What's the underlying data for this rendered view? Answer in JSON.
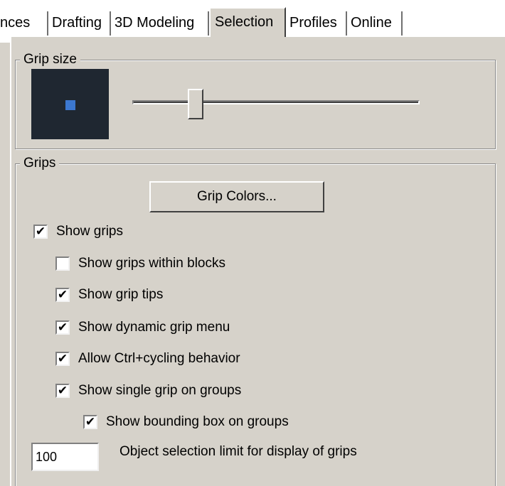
{
  "tabs": [
    {
      "label": "nces",
      "active": false
    },
    {
      "label": "Drafting",
      "active": false
    },
    {
      "label": "3D Modeling",
      "active": false
    },
    {
      "label": "Selection",
      "active": true
    },
    {
      "label": "Profiles",
      "active": false
    },
    {
      "label": "Online",
      "active": false
    }
  ],
  "grip_size": {
    "title": "Grip size",
    "preview_background": "#1f2731",
    "grip_color": "#3c78d0",
    "slider_level": 0.22
  },
  "grips": {
    "title": "Grips",
    "grip_colors_button": "Grip Colors...",
    "checkboxes": [
      {
        "label": "Show grips",
        "checked": true
      },
      {
        "label": "Show grips within blocks",
        "checked": false
      },
      {
        "label": "Show grip tips",
        "checked": true
      },
      {
        "label": "Show dynamic grip menu",
        "checked": true
      },
      {
        "label": "Allow Ctrl+cycling behavior",
        "checked": true
      },
      {
        "label": "Show single grip on groups",
        "checked": true
      },
      {
        "label": "Show bounding box on groups",
        "checked": true
      }
    ],
    "selection_limit_value": "100",
    "selection_limit_label": "Object selection limit for display of grips"
  }
}
